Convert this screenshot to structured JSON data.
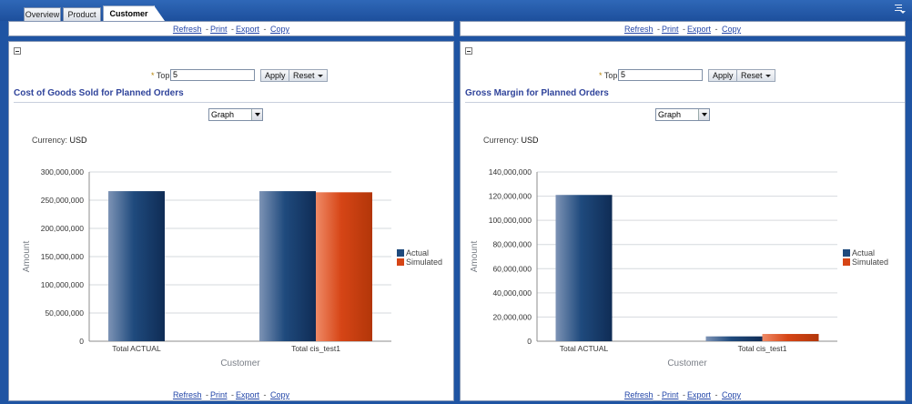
{
  "tabs": [
    {
      "label": "Overview",
      "active": false
    },
    {
      "label": "Product",
      "active": false
    },
    {
      "label": "Customer",
      "active": true
    }
  ],
  "links": {
    "refresh": "Refresh",
    "print": "Print",
    "export": "Export",
    "copy": "Copy",
    "sep": "-"
  },
  "colors": {
    "actual": "#1f4a7d",
    "simulated": "#d64516",
    "title": "#30449b",
    "link": "#2346a8"
  },
  "left": {
    "top_label": "Top",
    "top_value": "5",
    "apply_label": "Apply",
    "reset_label": "Reset",
    "title": "Cost of Goods Sold for Planned Orders",
    "view_select": "Graph",
    "currency_label": "Currency:",
    "currency_value": "USD",
    "chart_data": {
      "type": "bar",
      "categories": [
        "Total ACTUAL",
        "Total cis_test1"
      ],
      "series": [
        {
          "name": "Actual",
          "values": [
            266000000,
            266000000
          ]
        },
        {
          "name": "Simulated",
          "values": [
            null,
            264000000
          ]
        }
      ],
      "xlabel": "Customer",
      "ylabel": "Amount",
      "ylim": [
        0,
        300000000
      ],
      "yticks": [
        "0",
        "50,000,000",
        "100,000,000",
        "150,000,000",
        "200,000,000",
        "250,000,000",
        "300,000,000"
      ],
      "grid": true,
      "legend": "right"
    }
  },
  "right": {
    "top_label": "Top",
    "top_value": "5",
    "apply_label": "Apply",
    "reset_label": "Reset",
    "title": "Gross Margin for Planned Orders",
    "view_select": "Graph",
    "currency_label": "Currency:",
    "currency_value": "USD",
    "chart_data": {
      "type": "bar",
      "categories": [
        "Total ACTUAL",
        "Total cis_test1"
      ],
      "series": [
        {
          "name": "Actual",
          "values": [
            121000000,
            4000000
          ]
        },
        {
          "name": "Simulated",
          "values": [
            null,
            6000000
          ]
        }
      ],
      "xlabel": "Customer",
      "ylabel": "Amount",
      "ylim": [
        0,
        140000000
      ],
      "yticks": [
        "0",
        "20,000,000",
        "40,000,000",
        "60,000,000",
        "80,000,000",
        "100,000,000",
        "120,000,000",
        "140,000,000"
      ],
      "grid": true,
      "legend": "right"
    }
  }
}
